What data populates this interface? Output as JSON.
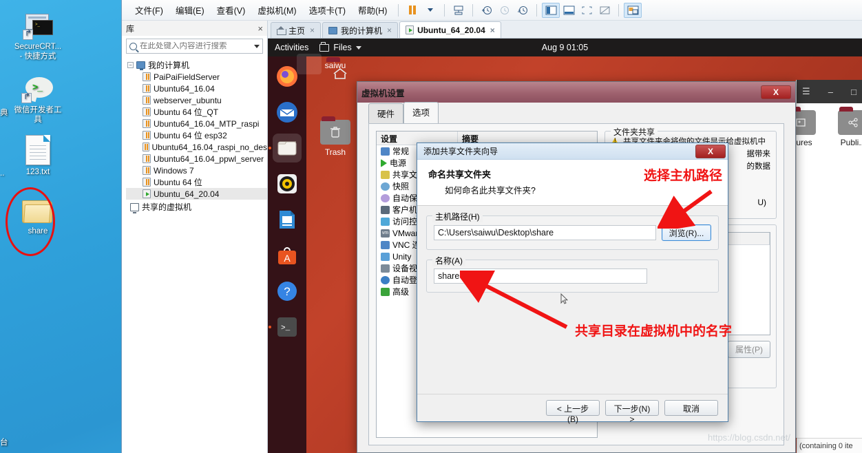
{
  "windows_desktop": {
    "icons": [
      {
        "name": "SecureCRT...",
        "sub": "- 快捷方式",
        "icon": "securecrt-icon"
      },
      {
        "name": "微信开发者工",
        "sub": "具",
        "icon": "wechat-devtools-icon"
      },
      {
        "name": "123.txt",
        "sub": "",
        "icon": "text-file-icon"
      },
      {
        "name": "share",
        "sub": "",
        "icon": "folder-icon"
      }
    ],
    "partial_labels": [
      "典",
      "..",
      "台"
    ]
  },
  "vmware": {
    "menu": [
      {
        "label": "文件(F)"
      },
      {
        "label": "编辑(E)"
      },
      {
        "label": "查看(V)"
      },
      {
        "label": "虚拟机(M)"
      },
      {
        "label": "选项卡(T)"
      },
      {
        "label": "帮助(H)"
      }
    ],
    "toolbar": [
      {
        "name": "pause-button",
        "icon": "pause-icon"
      },
      {
        "name": "pause-dropdown",
        "icon": "caret-down-icon"
      },
      {
        "name": "send-ctrl-alt-del-button",
        "icon": "keyboard-icon"
      },
      {
        "name": "snapshot-take-button",
        "icon": "clock-plus-icon"
      },
      {
        "name": "snapshot-revert-button",
        "icon": "clock-back-icon"
      },
      {
        "name": "snapshot-manager-button",
        "icon": "clock-manage-icon"
      },
      {
        "name": "show-library-button",
        "icon": "sidebar-panel-icon"
      },
      {
        "name": "show-thumbnail-bar-button",
        "icon": "thumbnail-bar-icon"
      },
      {
        "name": "fullscreen-button",
        "icon": "fullscreen-icon"
      },
      {
        "name": "unity-mode-button",
        "icon": "unity-icon"
      },
      {
        "name": "console-view-button",
        "icon": "console-view-icon"
      }
    ],
    "library": {
      "title": "库",
      "close_label": "×",
      "search_placeholder": "在此处键入内容进行搜索",
      "search_value": "",
      "root": "我的计算机",
      "vms": [
        "PaiPaiFieldServer",
        "Ubuntu64_16.04",
        "webserver_ubuntu",
        "Ubuntu 64 位_QT",
        "Ubuntu64_16.04_MTP_raspi",
        "Ubuntu 64 位 esp32",
        "Ubuntu64_16.04_raspi_no_des",
        "Ubuntu64_16.04_ppwl_server",
        "Windows 7",
        "Ubuntu 64 位"
      ],
      "running_vm": "Ubuntu_64_20.04",
      "shared_vms": "共享的虚拟机"
    },
    "tabs": [
      {
        "label": "主页",
        "icon": "home-icon",
        "active": false
      },
      {
        "label": "我的计算机",
        "icon": "monitor-icon",
        "active": false
      },
      {
        "label": "Ubuntu_64_20.04",
        "icon": "vm-running-icon",
        "active": true
      }
    ]
  },
  "guest": {
    "topbar": {
      "activities": "Activities",
      "app": "Files",
      "clock": "Aug 9  01:05"
    },
    "dock": [
      {
        "name": "firefox",
        "icon": "firefox-icon"
      },
      {
        "name": "thunderbird",
        "icon": "mail-icon"
      },
      {
        "name": "files",
        "icon": "files-icon"
      },
      {
        "name": "rhythmbox",
        "icon": "music-icon"
      },
      {
        "name": "libreoffice-writer",
        "icon": "document-icon"
      },
      {
        "name": "ubuntu-software",
        "icon": "software-icon"
      },
      {
        "name": "help",
        "icon": "help-icon"
      },
      {
        "name": "terminal",
        "icon": "terminal-icon"
      }
    ],
    "desktop_icons": [
      {
        "label": "saiwu",
        "icon": "home-folder-icon"
      },
      {
        "label": "Trash",
        "icon": "trash-icon"
      }
    ],
    "nautilus_icons": [
      {
        "label": "...ures",
        "icon": "pictures-folder-icon"
      },
      {
        "label": "Publi...",
        "icon": "public-share-folder-icon"
      }
    ],
    "nautilus_status": "(containing 0 ite"
  },
  "vm_settings": {
    "title": "虚拟机设置",
    "close_label": "X",
    "tabs": [
      {
        "label": "硬件",
        "active": false
      },
      {
        "label": "选项",
        "active": true
      }
    ],
    "columns": [
      "设置",
      "摘要"
    ],
    "settings_rows": [
      {
        "label": "常规",
        "icon": "general-icon",
        "color": "#4f86c6",
        "summary": ""
      },
      {
        "label": "电源",
        "icon": "power-icon",
        "color": "#2faa2f",
        "summary": ""
      },
      {
        "label": "共享文件夹",
        "icon": "shared-folders-icon",
        "color": "#d8c24a",
        "summary": ""
      },
      {
        "label": "快照",
        "icon": "snapshot-icon",
        "color": "#6ea7d4",
        "summary": ""
      },
      {
        "label": "自动保护",
        "icon": "autoprotect-icon",
        "color": "#b39ddb",
        "summary": ""
      },
      {
        "label": "客户机隔离",
        "icon": "guest-isolation-icon",
        "color": "#5b6b7a",
        "summary": ""
      },
      {
        "label": "访问控制",
        "icon": "access-control-icon",
        "color": "#4fa8d8",
        "summary": ""
      },
      {
        "label": "VMware Tools",
        "icon": "vmware-tools-icon",
        "color": "#6f7d8b",
        "summary": ""
      },
      {
        "label": "VNC 连接",
        "icon": "vnc-icon",
        "color": "#4f86c6",
        "summary": ""
      },
      {
        "label": "Unity",
        "icon": "unity-icon",
        "color": "#5aa0d8",
        "summary": ""
      },
      {
        "label": "设备视图",
        "icon": "device-view-icon",
        "color": "#7c8b99",
        "summary": ""
      },
      {
        "label": "自动登录",
        "icon": "autologin-icon",
        "color": "#3b7fc4",
        "summary": ""
      },
      {
        "label": "高级",
        "icon": "advanced-icon",
        "color": "#3aa33a",
        "summary": ""
      }
    ],
    "folder_sharing": {
      "legend": "文件夹共享",
      "warning_line1": "共享文件夹会将你的文件显示给虚拟机中",
      "warning_line2_right": "据带来",
      "warning_line3_right": "的数据",
      "option_tail": "U)",
      "properties_button": "属性(P)"
    }
  },
  "wizard": {
    "title": "添加共享文件夹向导",
    "close_label": "X",
    "heading": "命名共享文件夹",
    "subheading": "如何命名此共享文件夹?",
    "host_path_label": "主机路径(H)",
    "host_path_value": "C:\\Users\\saiwu\\Desktop\\share",
    "browse_button": "浏览(R)...",
    "name_label": "名称(A)",
    "name_value": "share",
    "buttons": {
      "back": "< 上一步(B)",
      "next": "下一步(N) >",
      "cancel": "取消"
    }
  },
  "annotations": [
    {
      "text": "选择主机路径",
      "name": "annotation-select-host-path"
    },
    {
      "text": "共享目录在虚拟机中的名字",
      "name": "annotation-share-name"
    }
  ],
  "watermark": "https://blog.csdn.net/",
  "colors": {
    "accent_red": "#f01414",
    "ubuntu_orange": "#e95420",
    "desktop_blue": "#2a9bd4"
  }
}
